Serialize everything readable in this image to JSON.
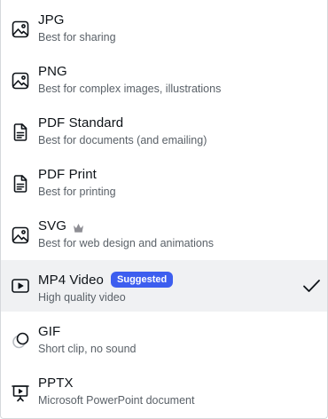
{
  "accent_color": "#3d5eef",
  "formats": [
    {
      "icon": "image-icon",
      "name": "JPG",
      "description": "Best for sharing"
    },
    {
      "icon": "image-icon",
      "name": "PNG",
      "description": "Best for complex images, illustrations"
    },
    {
      "icon": "document-icon",
      "name": "PDF Standard",
      "description": "Best for documents (and emailing)"
    },
    {
      "icon": "document-icon",
      "name": "PDF Print",
      "description": "Best for printing"
    },
    {
      "icon": "image-icon",
      "name": "SVG",
      "description": "Best for web design and animations",
      "premium_icon": "crown-icon"
    },
    {
      "icon": "video-icon",
      "name": "MP4 Video",
      "description": "High quality video",
      "badge": "Suggested",
      "selected": true
    },
    {
      "icon": "gif-icon",
      "name": "GIF",
      "description": "Short clip, no sound"
    },
    {
      "icon": "presentation-icon",
      "name": "PPTX",
      "description": "Microsoft PowerPoint document"
    }
  ]
}
